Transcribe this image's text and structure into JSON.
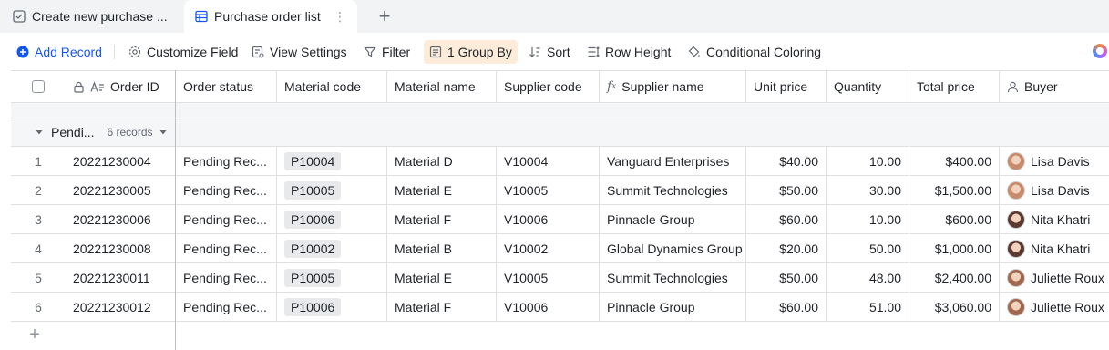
{
  "tabs": [
    {
      "label": "Create new purchase ...",
      "icon": "checklist-icon"
    },
    {
      "label": "Purchase order list",
      "icon": "grid-table-icon"
    }
  ],
  "toolbar": {
    "add_record": "Add Record",
    "customize_field": "Customize Field",
    "view_settings": "View Settings",
    "filter": "Filter",
    "group_by": "1 Group By",
    "sort": "Sort",
    "row_height": "Row Height",
    "conditional_coloring": "Conditional Coloring"
  },
  "columns": {
    "order_id": "Order ID",
    "order_status": "Order status",
    "material_code": "Material code",
    "material_name": "Material name",
    "supplier_code": "Supplier code",
    "supplier_name": "Supplier name",
    "unit_price": "Unit price",
    "quantity": "Quantity",
    "total_price": "Total price",
    "buyer": "Buyer"
  },
  "group": {
    "label": "Pendi...",
    "count": "6 records"
  },
  "rows": [
    {
      "num": "1",
      "order_id": "20221230004",
      "status": "Pending Rec...",
      "material_code": "P10004",
      "material_name": "Material D",
      "supplier_code": "V10004",
      "supplier_name": "Vanguard Enterprises",
      "unit_price": "$40.00",
      "quantity": "10.00",
      "total": "$400.00",
      "buyer": "Lisa Davis",
      "avatar_color": "#c98a6b"
    },
    {
      "num": "2",
      "order_id": "20221230005",
      "status": "Pending Rec...",
      "material_code": "P10005",
      "material_name": "Material E",
      "supplier_code": "V10005",
      "supplier_name": "Summit Technologies",
      "unit_price": "$50.00",
      "quantity": "30.00",
      "total": "$1,500.00",
      "buyer": "Lisa Davis",
      "avatar_color": "#c98a6b"
    },
    {
      "num": "3",
      "order_id": "20221230006",
      "status": "Pending Rec...",
      "material_code": "P10006",
      "material_name": "Material F",
      "supplier_code": "V10006",
      "supplier_name": "Pinnacle Group",
      "unit_price": "$60.00",
      "quantity": "10.00",
      "total": "$600.00",
      "buyer": "Nita Khatri",
      "avatar_color": "#5a3a30"
    },
    {
      "num": "4",
      "order_id": "20221230008",
      "status": "Pending Rec...",
      "material_code": "P10002",
      "material_name": "Material B",
      "supplier_code": "V10002",
      "supplier_name": "Global Dynamics Group",
      "unit_price": "$20.00",
      "quantity": "50.00",
      "total": "$1,000.00",
      "buyer": "Nita Khatri",
      "avatar_color": "#5a3a30"
    },
    {
      "num": "5",
      "order_id": "20221230011",
      "status": "Pending Rec...",
      "material_code": "P10005",
      "material_name": "Material E",
      "supplier_code": "V10005",
      "supplier_name": "Summit Technologies",
      "unit_price": "$50.00",
      "quantity": "48.00",
      "total": "$2,400.00",
      "buyer": "Juliette Roux",
      "avatar_color": "#a0684e"
    },
    {
      "num": "6",
      "order_id": "20221230012",
      "status": "Pending Rec...",
      "material_code": "P10006",
      "material_name": "Material F",
      "supplier_code": "V10006",
      "supplier_name": "Pinnacle Group",
      "unit_price": "$60.00",
      "quantity": "51.00",
      "total": "$3,060.00",
      "buyer": "Juliette Roux",
      "avatar_color": "#a0684e"
    }
  ],
  "colors": {
    "accent": "#1456f0",
    "active_bg": "#fdecd9",
    "border": "#dee0e3"
  }
}
